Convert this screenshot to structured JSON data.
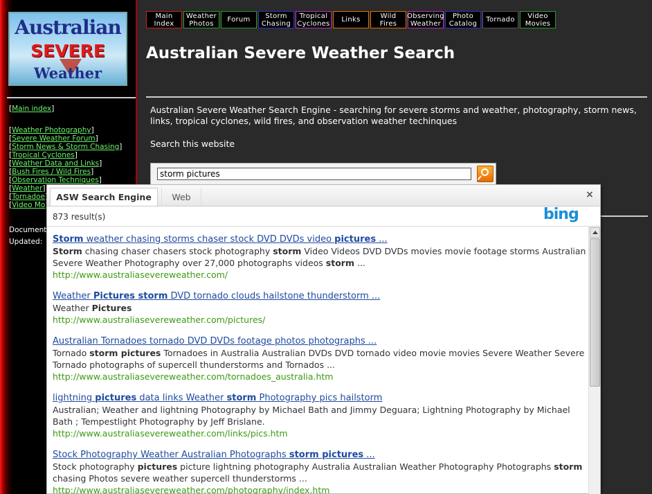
{
  "logo": {
    "line1": "Australian",
    "line2": "SEVERE",
    "line3": "Weather"
  },
  "topnav": [
    {
      "label": "Main\nIndex",
      "color": "#d02020",
      "w": 52
    },
    {
      "label": "Weather\nPhotos",
      "color": "#2a9a2a",
      "w": 52
    },
    {
      "label": "Forum",
      "color": "#2a9a2a",
      "w": 52
    },
    {
      "label": "Storm\nChasing",
      "color": "#3030d0",
      "w": 52
    },
    {
      "label": "Tropical\nCyclones",
      "color": "#c030c0",
      "w": 52
    },
    {
      "label": "Links",
      "color": "#e07000",
      "w": 52
    },
    {
      "label": "Wild\nFires",
      "color": "#e07000",
      "w": 52
    },
    {
      "label": "Observing\nWeather",
      "color": "#c030c0",
      "w": 52
    },
    {
      "label": "Photo\nCatalog",
      "color": "#3030d0",
      "w": 52
    },
    {
      "label": "Tornado",
      "color": "#555555",
      "w": 52
    },
    {
      "label": "Video\nMovies",
      "color": "#2a9a2a",
      "w": 52
    }
  ],
  "page_title": "Australian Severe Weather Search",
  "sidebar": {
    "main_index": "Main index",
    "links": [
      "Weather Photography",
      "Severe Weather Forum",
      "Storm News & Storm Chasing",
      "Tropical Cyclones",
      "Weather Data and Links",
      "Bush Fires / Wild Fires",
      "Observation Techniques",
      "Weather",
      "Tornadoe",
      "Video Mo"
    ],
    "meta_document": "Document",
    "meta_updated": "Updated:"
  },
  "intro": "Australian Severe Weather Search Engine - searching for severe storms and weather, photography, storm news, links, tropical cyclones, wild fires, and observation weather techinques",
  "search": {
    "label": "Search this website",
    "value": "storm pictures"
  },
  "results_panel": {
    "tab_asw": "ASW Search Engine",
    "tab_web": "Web",
    "close": "×",
    "count": "873 result(s)",
    "bing": "bing",
    "items": [
      {
        "title_html": "<b>Storm</b> weather chasing storms chaser stock DVD DVDs video <b>pictures</b> ...",
        "desc_html": "<b>Storm</b> chasing chaser chasers stock photography <b>storm</b> Video Videos DVD DVDs movies movie footage storms Australian Severe Weather Photography over 27,000 photographs videos <b>storm</b> ...",
        "url": "http://www.australiasevereweather.com/"
      },
      {
        "title_html": "Weather <b>Pictures storm</b> DVD tornado clouds hailstone thunderstorm ...",
        "desc_html": "Weather <b>Pictures</b>",
        "url": "http://www.australiasevereweather.com/pictures/"
      },
      {
        "title_html": "Australian Tornadoes tornado DVD DVDs footage photos photographs ...",
        "desc_html": "Tornado <b>storm pictures</b> Tornadoes in Australia Australian DVDs DVD tornado video movie movies Severe Weather Severe Tornado photographs of supercell thunderstorms and Tornados ...",
        "url": "http://www.australiasevereweather.com/tornadoes_australia.htm"
      },
      {
        "title_html": "lightning <b>pictures</b> data links Weather <b>storm</b> Photography pics hailstorm",
        "desc_html": "Australian; Weather and lightning Photography by Michael Bath and Jimmy Deguara; Lightning Photography by Michael Bath ; Tempestlight Photography by Jeff Brislane.",
        "url": "http://www.australiasevereweather.com/links/pics.htm"
      },
      {
        "title_html": "Stock Photography Weather Australian Photographs <b>storm pictures</b> ...",
        "desc_html": "Stock photography <b>pictures</b> picture lightning photography Australia Australian Weather Photography Photographs <b>storm</b> chasing Photos severe weather supercell thunderstorms ...",
        "url": "http://www.australiasevereweather.com/photography/index.htm"
      }
    ]
  }
}
